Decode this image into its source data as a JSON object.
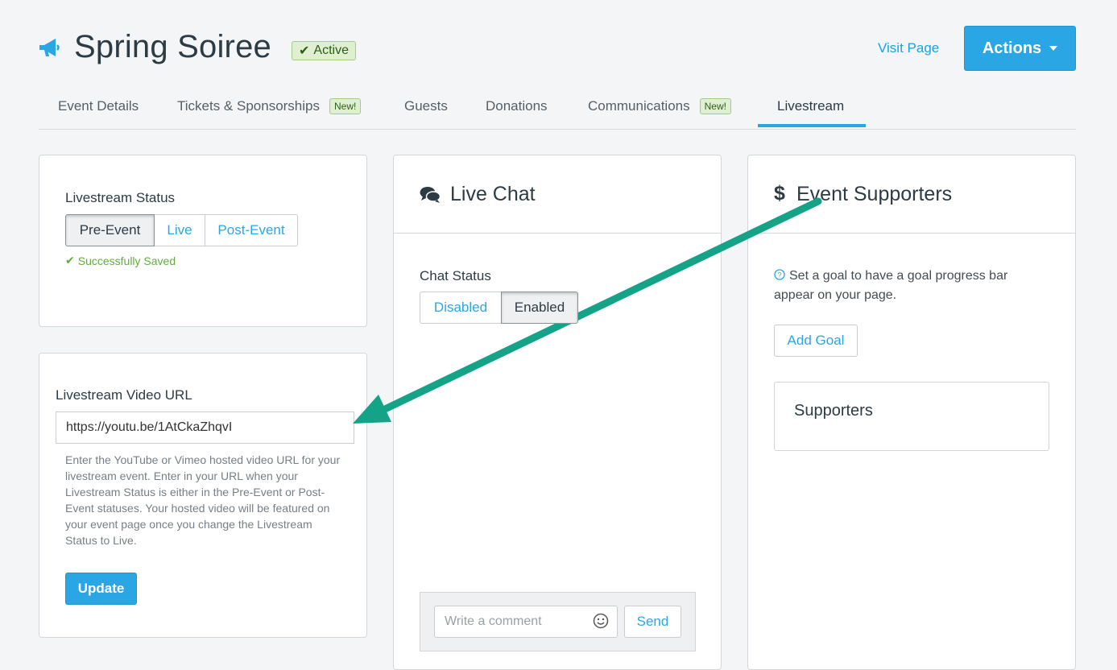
{
  "header": {
    "title": "Spring Soiree",
    "status_badge": "Active",
    "visit_page_label": "Visit Page",
    "actions_label": "Actions"
  },
  "tabs": [
    {
      "label": "Event Details",
      "badge": ""
    },
    {
      "label": "Tickets & Sponsorships",
      "badge": "New!"
    },
    {
      "label": "Guests",
      "badge": ""
    },
    {
      "label": "Donations",
      "badge": ""
    },
    {
      "label": "Communications",
      "badge": "New!"
    },
    {
      "label": "Livestream",
      "badge": "",
      "active": true
    }
  ],
  "livestream_status": {
    "label": "Livestream Status",
    "options": [
      "Pre-Event",
      "Live",
      "Post-Event"
    ],
    "selected": "Pre-Event",
    "saved_message": "Successfully Saved"
  },
  "video_url": {
    "label": "Livestream Video URL",
    "value": "https://youtu.be/1AtCkaZhqvI",
    "help_text": "Enter the YouTube or Vimeo hosted video URL for your livestream event. Enter in your URL when your Livestream Status is either in the Pre-Event or Post-Event statuses. Your hosted video will be featured on your event page once you change the Livestream Status to Live.",
    "update_label": "Update"
  },
  "live_chat": {
    "title": "Live Chat",
    "status_label": "Chat Status",
    "options": [
      "Disabled",
      "Enabled"
    ],
    "selected": "Enabled",
    "comment_placeholder": "Write a comment",
    "send_label": "Send"
  },
  "supporters": {
    "title": "Event Supporters",
    "title_symbol": "$",
    "goal_text": "Set a goal to have a goal progress bar appear on your page.",
    "add_goal_label": "Add Goal",
    "list_heading": "Supporters"
  },
  "colors": {
    "accent": "#2ba6e5",
    "success": "#5fae3b",
    "annotation_arrow": "#14a386"
  }
}
